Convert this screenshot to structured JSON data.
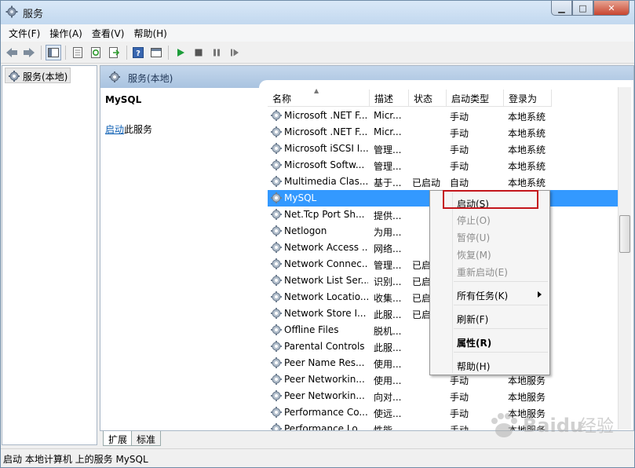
{
  "window": {
    "title": "服务",
    "icon": "gear-icon"
  },
  "menu": [
    "文件(F)",
    "操作(A)",
    "查看(V)",
    "帮助(H)"
  ],
  "toolbar": {
    "icons": [
      "back-arrow-icon",
      "forward-arrow-icon",
      "console-tree-icon",
      "properties-icon",
      "refresh-icon",
      "export-icon",
      "help-icon",
      "show-pane-icon",
      "play-icon",
      "stop-icon",
      "pause-icon",
      "resume-icon"
    ]
  },
  "tree": {
    "root_label": "服务(本地)"
  },
  "main": {
    "header": "服务(本地)",
    "selected_name": "MySQL",
    "action_link": "启动",
    "action_suffix": "此服务"
  },
  "columns": [
    "名称",
    "描述",
    "状态",
    "启动类型",
    "登录为"
  ],
  "rows": [
    {
      "name": "Microsoft .NET F...",
      "desc": "Micr...",
      "status": "",
      "type": "手动",
      "logon": "本地系统"
    },
    {
      "name": "Microsoft .NET F...",
      "desc": "Micr...",
      "status": "",
      "type": "手动",
      "logon": "本地系统"
    },
    {
      "name": "Microsoft iSCSI I...",
      "desc": "管理...",
      "status": "",
      "type": "手动",
      "logon": "本地系统"
    },
    {
      "name": "Microsoft Softw...",
      "desc": "管理...",
      "status": "",
      "type": "手动",
      "logon": "本地系统"
    },
    {
      "name": "Multimedia Clas...",
      "desc": "基于...",
      "status": "已启动",
      "type": "自动",
      "logon": "本地系统"
    },
    {
      "name": "MySQL",
      "desc": "",
      "status": "",
      "type": "",
      "logon": "",
      "selected": true
    },
    {
      "name": "Net.Tcp Port Sh...",
      "desc": "提供...",
      "status": "",
      "type": "",
      "logon": ""
    },
    {
      "name": "Netlogon",
      "desc": "为用...",
      "status": "",
      "type": "",
      "logon": ""
    },
    {
      "name": "Network Access ...",
      "desc": "网络...",
      "status": "",
      "type": "",
      "logon": ""
    },
    {
      "name": "Network Connec...",
      "desc": "管理...",
      "status": "已启",
      "type": "",
      "logon": ""
    },
    {
      "name": "Network List Ser...",
      "desc": "识别...",
      "status": "已启",
      "type": "",
      "logon": ""
    },
    {
      "name": "Network Locatio...",
      "desc": "收集...",
      "status": "已启",
      "type": "",
      "logon": ""
    },
    {
      "name": "Network Store I...",
      "desc": "此服...",
      "status": "已启",
      "type": "",
      "logon": ""
    },
    {
      "name": "Offline Files",
      "desc": "脱机...",
      "status": "",
      "type": "",
      "logon": ""
    },
    {
      "name": "Parental Controls",
      "desc": "此服...",
      "status": "",
      "type": "",
      "logon": ""
    },
    {
      "name": "Peer Name Res...",
      "desc": "使用...",
      "status": "",
      "type": "",
      "logon": ""
    },
    {
      "name": "Peer Networkin...",
      "desc": "使用...",
      "status": "",
      "type": "手动",
      "logon": "本地服务"
    },
    {
      "name": "Peer Networkin...",
      "desc": "向对...",
      "status": "",
      "type": "手动",
      "logon": "本地服务"
    },
    {
      "name": "Performance Co...",
      "desc": "使远...",
      "status": "",
      "type": "手动",
      "logon": "本地服务"
    },
    {
      "name": "Performance Lo...",
      "desc": "性能...",
      "status": "",
      "type": "手动",
      "logon": "本地服务"
    }
  ],
  "context_menu": {
    "items": [
      {
        "label": "启动(S)",
        "state": "enabled"
      },
      {
        "label": "停止(O)",
        "state": "disabled"
      },
      {
        "label": "暂停(U)",
        "state": "disabled"
      },
      {
        "label": "恢复(M)",
        "state": "disabled"
      },
      {
        "label": "重新启动(E)",
        "state": "disabled"
      },
      {
        "label": "所有任务(K)",
        "state": "enabled",
        "submenu": true
      },
      {
        "label": "刷新(F)",
        "state": "enabled"
      },
      {
        "label": "属性(R)",
        "state": "bold"
      },
      {
        "label": "帮助(H)",
        "state": "enabled"
      }
    ],
    "highlight_color": "#c4161c"
  },
  "tabs": [
    "扩展",
    "标准"
  ],
  "status_bar": "启动 本地计算机 上的服务 MySQL",
  "watermark": "Baidu 经验",
  "colors": {
    "selection": "#3399ff",
    "link": "#0b5eb3",
    "header_bg": "#b5cce6"
  }
}
